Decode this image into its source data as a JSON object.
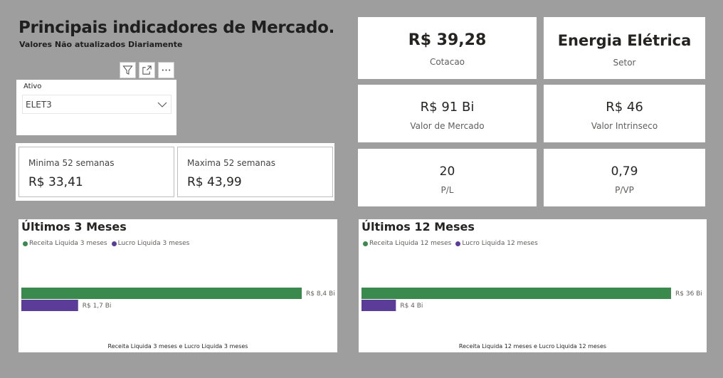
{
  "header": {
    "title": "Principais indicadores de Mercado.",
    "subtitle": "Valores Não atualizados Diariamente"
  },
  "toolbar": {
    "icons": [
      "filter-icon",
      "focus-mode-icon",
      "more-options-icon"
    ]
  },
  "slicer": {
    "label": "Ativo",
    "selected": "ELET3"
  },
  "range": {
    "min_label": "Minima 52 semanas",
    "min_value": "R$ 33,41",
    "max_label": "Maxima 52 semanas",
    "max_value": "R$ 43,99"
  },
  "kpis": {
    "cotacao_value": "R$ 39,28",
    "cotacao_label": "Cotacao",
    "setor_value": "Energia Elétrica",
    "setor_label": "Setor",
    "valor_mercado_value": "R$ 91 Bi",
    "valor_mercado_label": "Valor de Mercado",
    "valor_intrinseco_value": "R$ 46",
    "valor_intrinseco_label": "Valor Intrinseco",
    "pl_value": "20",
    "pl_label": "P/L",
    "pvp_value": "0,79",
    "pvp_label": "P/VP"
  },
  "colors": {
    "background": "#9e9e9e",
    "receita": "#3a8a4e",
    "lucro": "#5b3c99"
  },
  "chart_data": [
    {
      "type": "bar",
      "orientation": "horizontal",
      "title": "Últimos 3 Meses",
      "xlabel": "Receita Liquida 3 meses e Lucro Liquida 3 meses",
      "units": "R$ Bi",
      "series": [
        {
          "name": "Receita Liquida 3 meses",
          "value": 8.4,
          "label": "R$ 8,4 Bi"
        },
        {
          "name": "Lucro Liquida 3 meses",
          "value": 1.7,
          "label": "R$ 1,7 Bi"
        }
      ]
    },
    {
      "type": "bar",
      "orientation": "horizontal",
      "title": "Últimos 12 Meses",
      "xlabel": "Receita Liquida 12 meses e Lucro Liquida 12 meses",
      "units": "R$ Bi",
      "series": [
        {
          "name": "Receita Liquida 12 meses",
          "value": 36,
          "label": "R$ 36 Bi"
        },
        {
          "name": "Lucro Liquida 12 meses",
          "value": 4,
          "label": "R$ 4 Bi"
        }
      ]
    }
  ]
}
